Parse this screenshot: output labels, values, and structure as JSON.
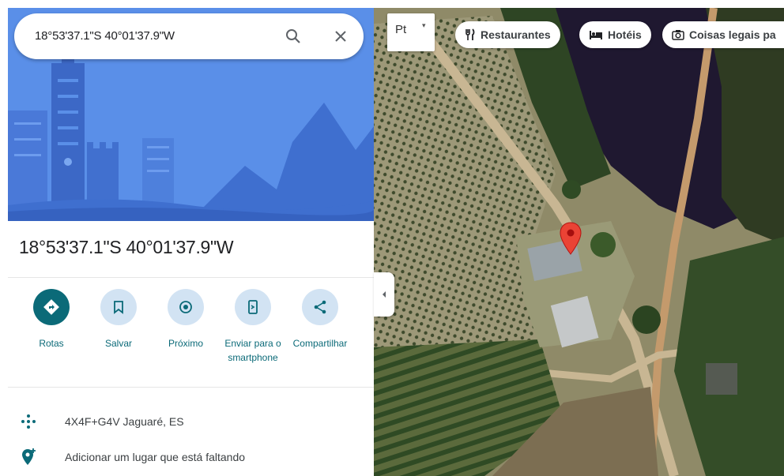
{
  "search": {
    "query": "18°53'37.1\"S 40°01'37.9\"W",
    "search_icon": "search-icon",
    "close_icon": "close-icon"
  },
  "place": {
    "title": "18°53'37.1\"S 40°01'37.9\"W"
  },
  "actions": [
    {
      "label": "Rotas",
      "icon": "directions-icon"
    },
    {
      "label": "Salvar",
      "icon": "bookmark-icon"
    },
    {
      "label": "Próximo",
      "icon": "nearby-icon"
    },
    {
      "label": "Enviar para o smartphone",
      "icon": "send-to-phone-icon"
    },
    {
      "label": "Compartilhar",
      "icon": "share-icon"
    }
  ],
  "info": {
    "plus_code": "4X4F+G4V Jaguaré, ES",
    "add_place": "Adicionar um lugar que está faltando"
  },
  "map": {
    "layer_label": "Pt",
    "chips": [
      {
        "label": "Restaurantes",
        "icon": "restaurant-icon"
      },
      {
        "label": "Hotéis",
        "icon": "hotel-icon"
      },
      {
        "label": "Coisas legais pa",
        "icon": "camera-icon"
      }
    ]
  },
  "colors": {
    "accent": "#0b6a78",
    "action_bg": "#d2e3f3",
    "hero_bg": "#4f87e6",
    "pin": "#ea4335"
  }
}
